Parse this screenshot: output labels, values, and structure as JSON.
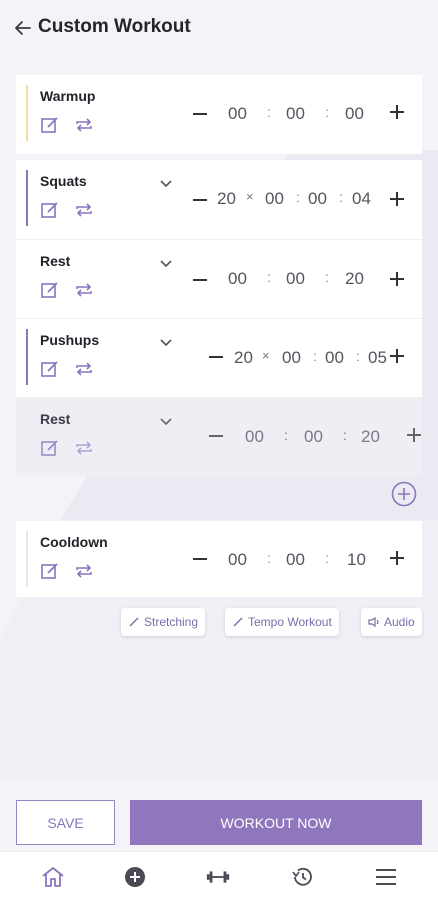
{
  "header": {
    "title": "Custom Workout"
  },
  "rows": [
    {
      "label": "Warmup",
      "count": "",
      "times": [
        "00",
        "00",
        "00"
      ]
    },
    {
      "label": "Squats",
      "count": "20",
      "times": [
        "00",
        "00",
        "04"
      ]
    },
    {
      "label": "Rest",
      "count": "",
      "times": [
        "00",
        "00",
        "20"
      ]
    },
    {
      "label": "Pushups",
      "count": "20",
      "times": [
        "00",
        "00",
        "05"
      ]
    },
    {
      "label": "Rest",
      "count": "",
      "times": [
        "00",
        "00",
        "20"
      ]
    },
    {
      "label": "Cooldown",
      "count": "",
      "times": [
        "00",
        "00",
        "10"
      ]
    }
  ],
  "symbols": {
    "times": "×",
    "colon": ":"
  },
  "chips": {
    "stretching": "Stretching",
    "tempo": "Tempo Workout",
    "audio": "Audio"
  },
  "actions": {
    "save": "SAVE",
    "workout_now": "WORKOUT NOW"
  },
  "colors": {
    "accent": "#9076bd",
    "warmup_accent": "#f3d9a4",
    "background": "#f4f3f8"
  },
  "nav": {
    "items": [
      "home-icon",
      "add-circle-icon",
      "dumbbell-icon",
      "history-icon",
      "menu-icon"
    ]
  }
}
